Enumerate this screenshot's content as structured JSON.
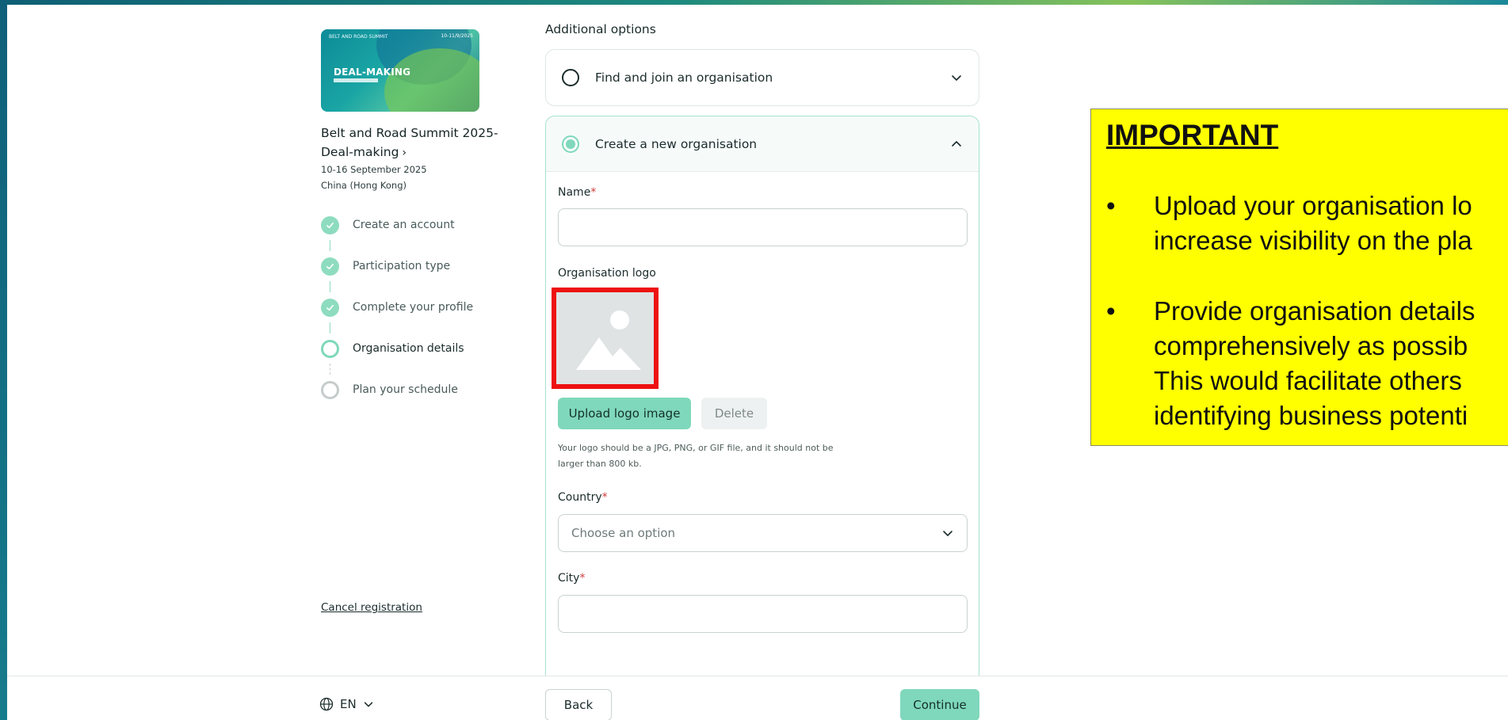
{
  "event": {
    "card_top_text": "BELT AND ROAD SUMMIT",
    "card_date": "10-11/9/2025",
    "card_title": "DEAL-MAKING",
    "title": "Belt and Road Summit 2025-Deal-making",
    "dates": "10-16 September 2025",
    "location": "China (Hong Kong)"
  },
  "steps": [
    {
      "label": "Create an account",
      "status": "done"
    },
    {
      "label": "Participation type",
      "status": "done"
    },
    {
      "label": "Complete your profile",
      "status": "done"
    },
    {
      "label": "Organisation details",
      "status": "current"
    },
    {
      "label": "Plan your schedule",
      "status": "todo"
    }
  ],
  "cancel_label": "Cancel registration",
  "section_heading": "Additional options",
  "options": {
    "find": {
      "label": "Find and join an organisation",
      "selected": false
    },
    "create": {
      "label": "Create a new organisation",
      "selected": true
    }
  },
  "form": {
    "name_label": "Name",
    "name_value": "",
    "logo_label": "Organisation logo",
    "upload_label": "Upload logo image",
    "delete_label": "Delete",
    "logo_hint": "Your logo should be a JPG, PNG, or GIF file, and it should not be larger than 800 kb.",
    "country_label": "Country",
    "country_placeholder": "Choose an option",
    "city_label": "City",
    "city_value": "",
    "required_mark": "*"
  },
  "footer": {
    "language": "EN",
    "back_label": "Back",
    "continue_label": "Continue"
  },
  "callout": {
    "title": "IMPORTANT",
    "bullet1_line1": "Upload your organisation lo",
    "bullet1_line2": "increase visibility on the pla",
    "bullet2_line1": "Provide organisation details",
    "bullet2_line2": "comprehensively as possib",
    "bullet2_line3": "This would facilitate others",
    "bullet2_line4": "identifying business potenti"
  },
  "colors": {
    "accent": "#7fd8bb",
    "highlight_border": "#ee1111",
    "callout_bg": "#ffff00",
    "required": "#d23b3b"
  }
}
